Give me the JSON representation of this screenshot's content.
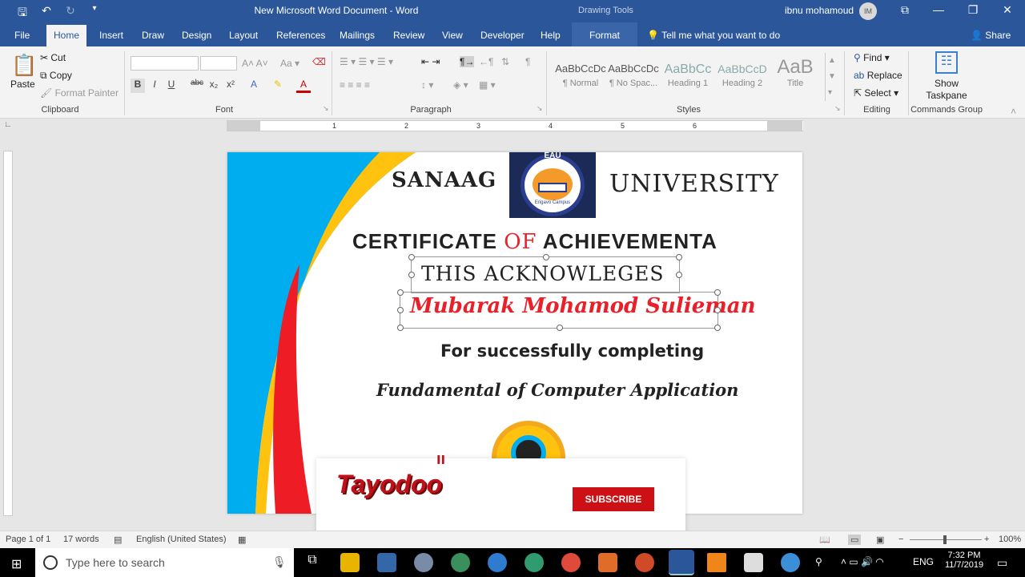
{
  "window": {
    "title": "New Microsoft Word Document  -  Word",
    "context_group": "Drawing Tools",
    "user": "ibnu mohamoud",
    "avatar_initials": "IM"
  },
  "qat": {
    "save_icon": "save-icon",
    "undo_icon": "undo-icon",
    "redo_icon": "redo-icon",
    "customize_icon": "customize-qat-icon"
  },
  "tabs": [
    "File",
    "Home",
    "Insert",
    "Draw",
    "Design",
    "Layout",
    "References",
    "Mailings",
    "Review",
    "View",
    "Developer",
    "Help",
    "Format"
  ],
  "tellme": "Tell me what you want to do",
  "share": "Share",
  "ribbon": {
    "clipboard": {
      "label": "Clipboard",
      "paste": "Paste",
      "cut": "Cut",
      "copy": "Copy",
      "format_painter": "Format Painter"
    },
    "font": {
      "label": "Font",
      "font_name": "",
      "font_size": "",
      "bold": "B",
      "italic": "I",
      "underline": "U",
      "strike": "abc",
      "sub": "x₂",
      "sup": "x²"
    },
    "paragraph": {
      "label": "Paragraph"
    },
    "styles": {
      "label": "Styles",
      "items": [
        {
          "preview": "AaBbCcDc",
          "name": "¶ Normal"
        },
        {
          "preview": "AaBbCcDc",
          "name": "¶ No Spac..."
        },
        {
          "preview": "AaBbCc",
          "name": "Heading 1"
        },
        {
          "preview": "AaBbCcD",
          "name": "Heading 2"
        },
        {
          "preview": "AaB",
          "name": "Title"
        }
      ]
    },
    "editing": {
      "label": "Editing",
      "find": "Find",
      "replace": "Replace",
      "select": "Select"
    },
    "commands": {
      "label": "Commands Group",
      "show_taskpane_1": "Show",
      "show_taskpane_2": "Taskpane"
    }
  },
  "ruler": [
    "1",
    "2",
    "3",
    "4",
    "5",
    "6"
  ],
  "certificate": {
    "left_word": "SANAAG",
    "right_word": "UNIVERSITY",
    "logo_top": "EAU",
    "logo_bottom": "Erigavo Campus",
    "heading_a": "CERTIFICATE ",
    "heading_of": "OF",
    "heading_b": " ACHIEVEMENTA",
    "acknowledges": "THIS ACKNOWLEGES",
    "recipient": "Mubarak Mohamod Sulieman",
    "completing": "For successfully completing",
    "course": "Fundamental of Computer Application",
    "colors": {
      "blue": "#00aeef",
      "yellow": "#ffc20e",
      "red": "#ee1c25",
      "recipient": "#e8202a"
    }
  },
  "overlay": {
    "brand": "Tayodoo",
    "subscribe": "SUBSCRIBE"
  },
  "status": {
    "page": "Page 1 of 1",
    "words": "17 words",
    "language": "English (United States)",
    "zoom": "100%"
  },
  "taskbar": {
    "search": "Type here to search",
    "lang": "ENG",
    "time": "7:32 PM",
    "date": "11/7/2019"
  }
}
